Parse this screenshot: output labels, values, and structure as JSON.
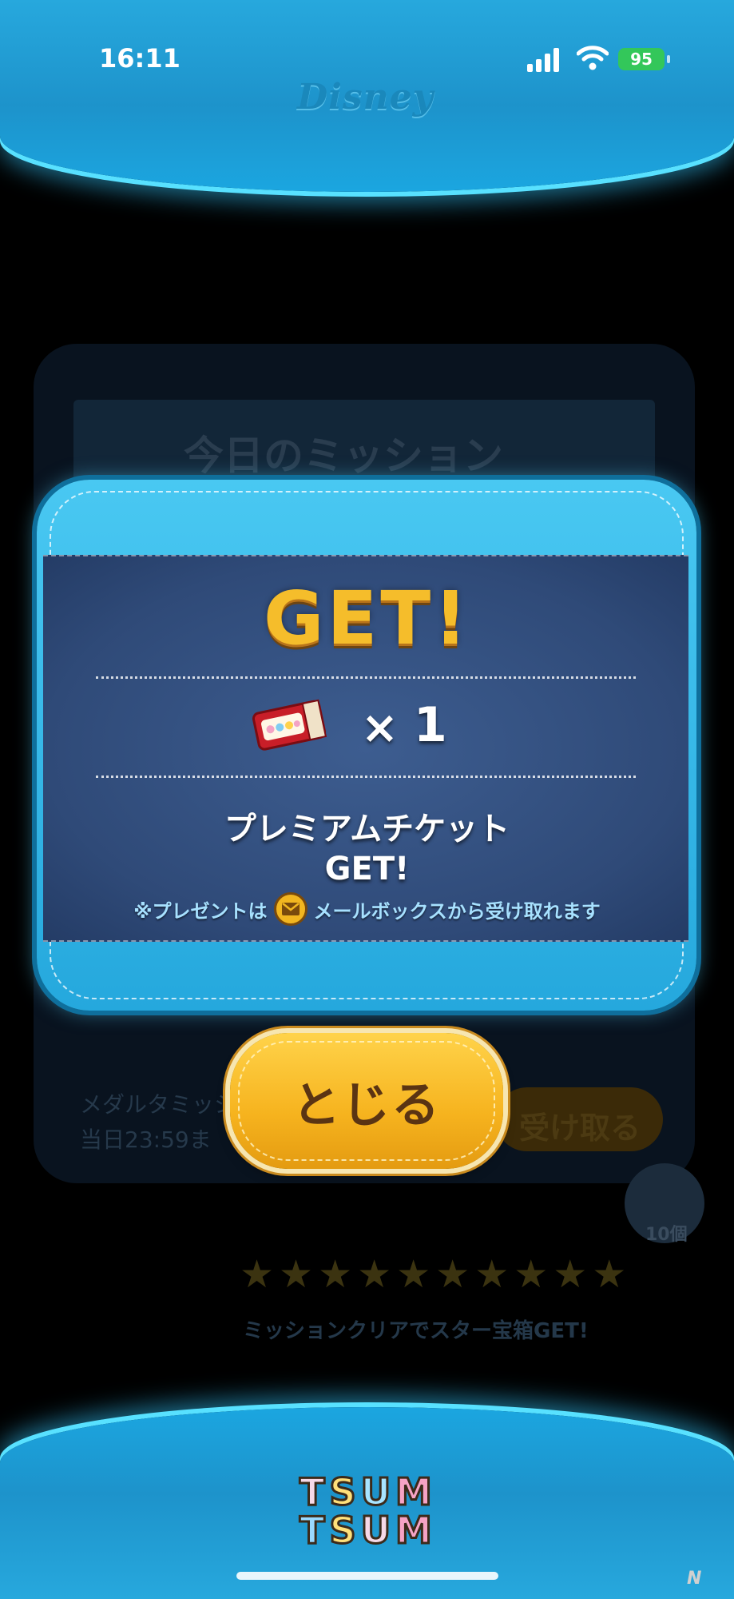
{
  "status_bar": {
    "time": "16:11",
    "battery": "95"
  },
  "header": {
    "brand": "Disney"
  },
  "background": {
    "title": "今日のミッション",
    "mission_text_1": "メダルタミッシ",
    "mission_text_2": "当日23:59ま",
    "button_label": "受け取る",
    "reward_badge": "10個",
    "stars_caption": "ミッションクリアでスター宝箱GET!"
  },
  "dialog": {
    "title": "GET!",
    "multiply_sign": "×",
    "quantity": "1",
    "reward_name": "プレミアムチケット",
    "reward_get": "GET!",
    "note_prefix": "※プレゼントは",
    "note_suffix": "メールボックスから受け取れます",
    "close_label": "とじる"
  },
  "footer": {
    "logo": [
      "T",
      "S",
      "U",
      "M",
      "T",
      "S",
      "U",
      "M"
    ]
  },
  "colors": {
    "frame_blue": "#1d93cb",
    "dialog_panel": "#2f4a78",
    "gold_title": "#f5bd2b",
    "close_button": "#f6b31e",
    "battery_green": "#33c75a"
  },
  "icons": {
    "signal": "signal-icon",
    "wifi": "wifi-icon",
    "ticket": "premium-ticket-icon",
    "mail": "mail-icon"
  }
}
